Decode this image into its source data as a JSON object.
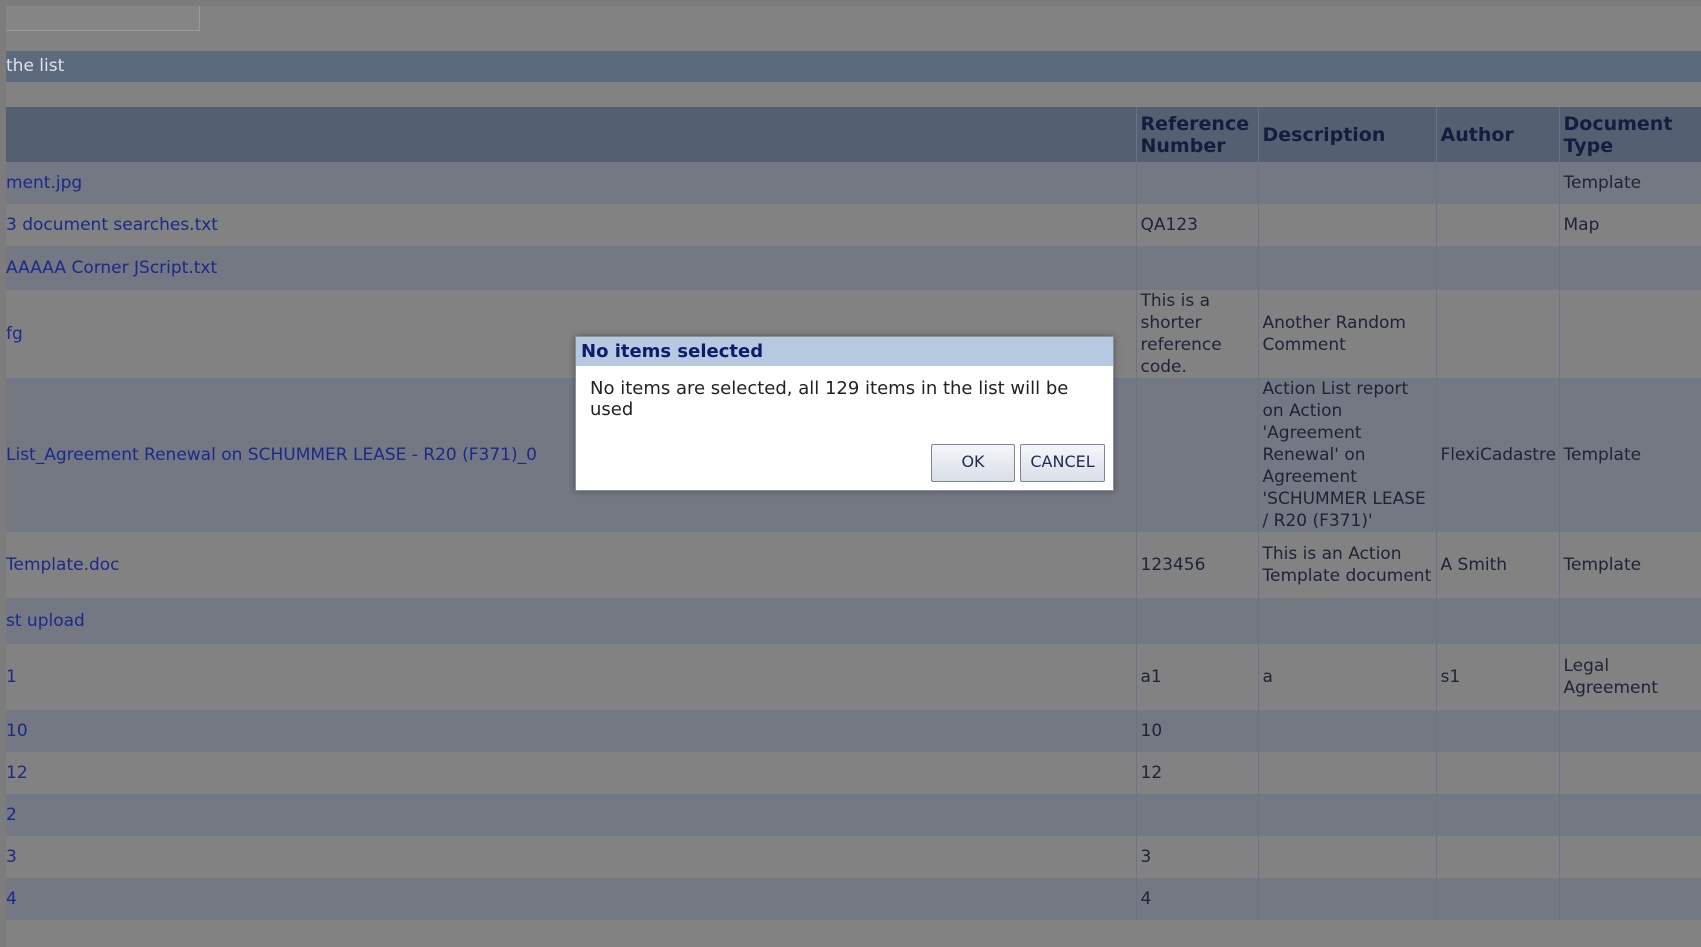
{
  "instruction": "the list",
  "table": {
    "headers": {
      "name": "",
      "reference": "Reference Number",
      "description": "Description",
      "author": "Author",
      "type": "Document Type"
    },
    "rows": [
      {
        "name": "ment.jpg",
        "reference": "",
        "description": "",
        "author": "",
        "type": "Template"
      },
      {
        "name": "3 document searches.txt",
        "reference": "QA123",
        "description": "",
        "author": "",
        "type": "Map"
      },
      {
        "name": "AAAAA Corner JScript.txt",
        "reference": "",
        "description": "",
        "author": "",
        "type": ""
      },
      {
        "name": "fg",
        "reference": "This is a shorter reference code.",
        "description": "Another Random Comment",
        "author": "",
        "type": ""
      },
      {
        "name": "List_Agreement Renewal on SCHUMMER LEASE - R20 (F371)_0",
        "reference": "",
        "description": "Action List report on Action 'Agreement Renewal' on Agreement 'SCHUMMER LEASE / R20 (F371)'",
        "author": "FlexiCadastre",
        "type": "Template"
      },
      {
        "name": "Template.doc",
        "reference": "123456",
        "description": "This is an Action Template document",
        "author": "A Smith",
        "type": "Template"
      },
      {
        "name": "st upload",
        "reference": "",
        "description": "",
        "author": "",
        "type": ""
      },
      {
        "name": "1",
        "reference": "a1",
        "description": "a",
        "author": "s1",
        "type": "Legal Agreement"
      },
      {
        "name": "10",
        "reference": "10",
        "description": "",
        "author": "",
        "type": ""
      },
      {
        "name": "12",
        "reference": "12",
        "description": "",
        "author": "",
        "type": ""
      },
      {
        "name": "2",
        "reference": "",
        "description": "",
        "author": "",
        "type": ""
      },
      {
        "name": "3",
        "reference": "3",
        "description": "",
        "author": "",
        "type": ""
      },
      {
        "name": "4",
        "reference": "4",
        "description": "",
        "author": "",
        "type": ""
      }
    ]
  },
  "dialog": {
    "title": "No items selected",
    "message": "No items are selected, all 129 items in the list will be used",
    "ok_label": "OK",
    "cancel_label": "CANCEL"
  }
}
